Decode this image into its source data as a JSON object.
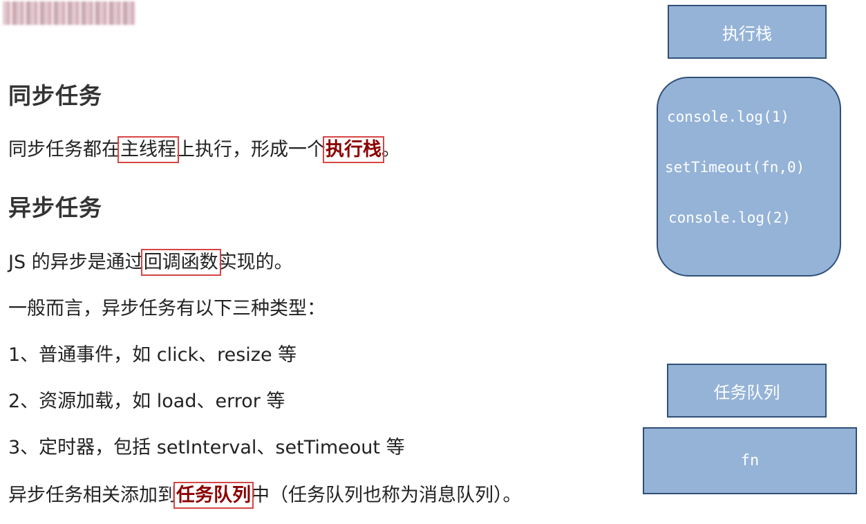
{
  "sync": {
    "heading": "同步任务",
    "line1_pre": "同步任务都在",
    "line1_box": "主线程",
    "line1_mid": "上执行，形成一个",
    "line1_strong": "执行栈",
    "line1_end": "。"
  },
  "async": {
    "heading": "异步任务",
    "line1_pre": "JS 的异步是通过",
    "line1_box": "回调函数",
    "line1_end": "实现的。",
    "line2": "一般而言，异步任务有以下三种类型：",
    "line3": "1、普通事件，如 click、resize 等",
    "line4": "2、资源加载，如 load、error 等",
    "line5": "3、定时器，包括 setInterval、setTimeout 等",
    "line6_pre": "异步任务相关添加到",
    "line6_strong": "任务队列",
    "line6_end": "中（任务队列也称为消息队列）。"
  },
  "diagram": {
    "stack_label": "执行栈",
    "stack_items": [
      "console.log(1)",
      "setTimeout(fn,0)",
      "console.log(2)"
    ],
    "queue_label": "任务队列",
    "queue_item": "fn",
    "box_color": "#95b3d7",
    "border_color": "#2f4f76"
  },
  "colors": {
    "highlight_border": "#d64545",
    "strong_text": "#8b0000"
  }
}
